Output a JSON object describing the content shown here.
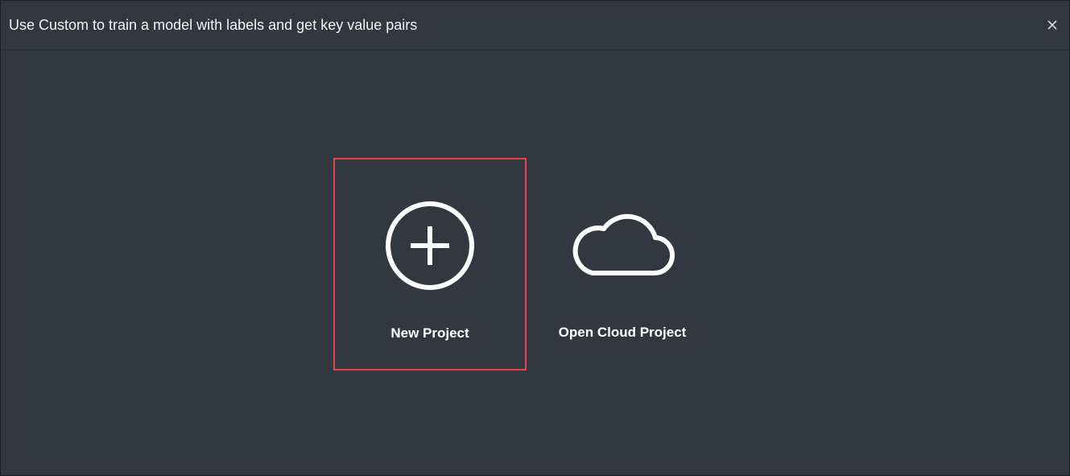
{
  "dialog": {
    "title": "Use Custom to train a model with labels and get key value pairs",
    "close_icon": "close-icon"
  },
  "options": [
    {
      "label": "New Project",
      "icon": "plus-circle-icon",
      "highlighted": true,
      "highlight_color": "#e0454a"
    },
    {
      "label": "Open Cloud Project",
      "icon": "cloud-icon",
      "highlighted": false
    }
  ],
  "colors": {
    "background": "#333740",
    "text": "#ffffff"
  }
}
